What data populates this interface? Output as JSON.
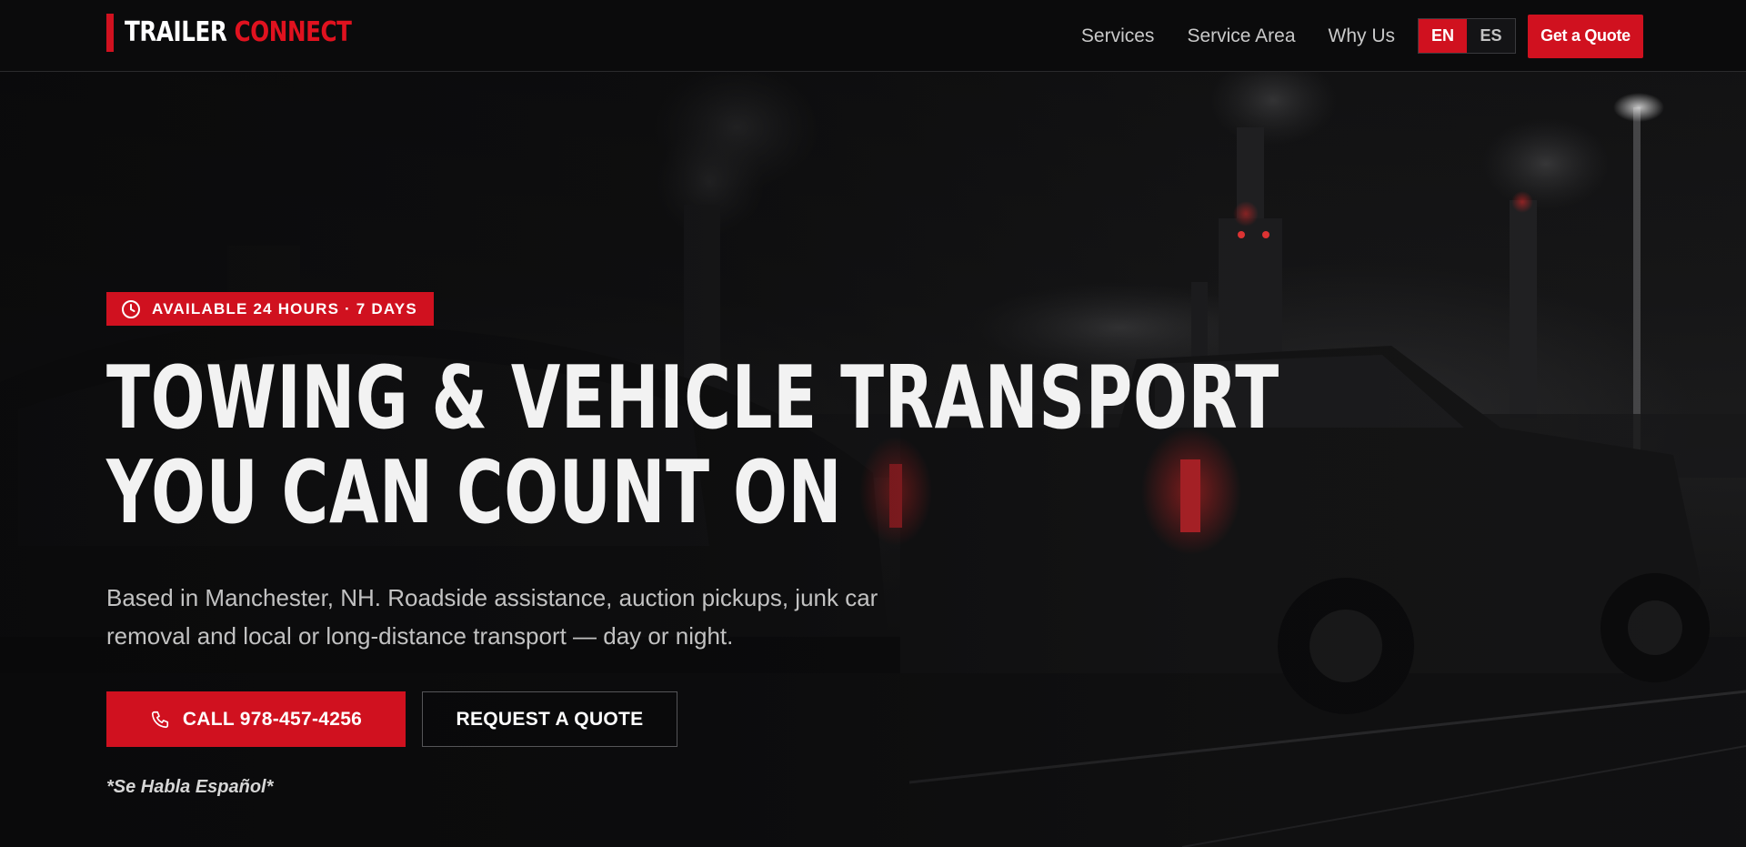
{
  "header": {
    "logo": {
      "part1": "TRAILER",
      "part2": "CONNECT"
    },
    "nav": [
      {
        "label": "Services"
      },
      {
        "label": "Service Area"
      },
      {
        "label": "Why Us"
      }
    ],
    "languages": [
      {
        "code": "EN",
        "active": true
      },
      {
        "code": "ES",
        "active": false
      }
    ],
    "cta_label": "Get a Quote"
  },
  "hero": {
    "badge": "AVAILABLE 24 HOURS · 7 DAYS",
    "headline_line1": "TOWING & VEHICLE TRANSPORT",
    "headline_line2": "YOU CAN COUNT ON",
    "subtext": "Based in Manchester, NH. Roadside assistance, auction pickups, junk car removal and local or long-distance transport — day or night.",
    "call_button": "CALL 978-457-4256",
    "quote_button": "REQUEST A QUOTE",
    "spanish_note": "*Se Habla Español*"
  },
  "icons": {
    "badge_icon": "clock-icon",
    "call_icon": "phone-icon"
  },
  "colors": {
    "accent": "#d0111f",
    "header_bg": "#0b0b0c",
    "text_primary": "#f2f2f2",
    "text_muted": "#c2c2c2"
  }
}
